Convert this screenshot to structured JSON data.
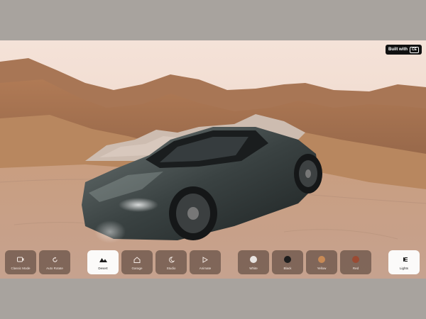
{
  "badge": {
    "text": "Built with",
    "logo": "CE"
  },
  "controls": {
    "left": [
      {
        "label": "Classic Mode",
        "icon": "camera-icon"
      },
      {
        "label": "Auto Rotate",
        "icon": "rotate-icon"
      }
    ],
    "scenes": [
      {
        "label": "Desert",
        "icon": "mountain-icon",
        "active": true
      },
      {
        "label": "Garage",
        "icon": "home-icon",
        "active": false
      },
      {
        "label": "Studio",
        "icon": "moon-icon",
        "active": false
      },
      {
        "label": "Animate",
        "icon": "play-icon",
        "active": false
      }
    ],
    "colors": [
      {
        "label": "White",
        "color": "#e8e4e1"
      },
      {
        "label": "Black",
        "color": "#1d1d1d"
      },
      {
        "label": "Yellow",
        "color": "#c88a55"
      },
      {
        "label": "Red",
        "color": "#9b4b33"
      }
    ],
    "right": [
      {
        "label": "Lights",
        "icon": "headlight-icon",
        "active": true
      }
    ]
  }
}
